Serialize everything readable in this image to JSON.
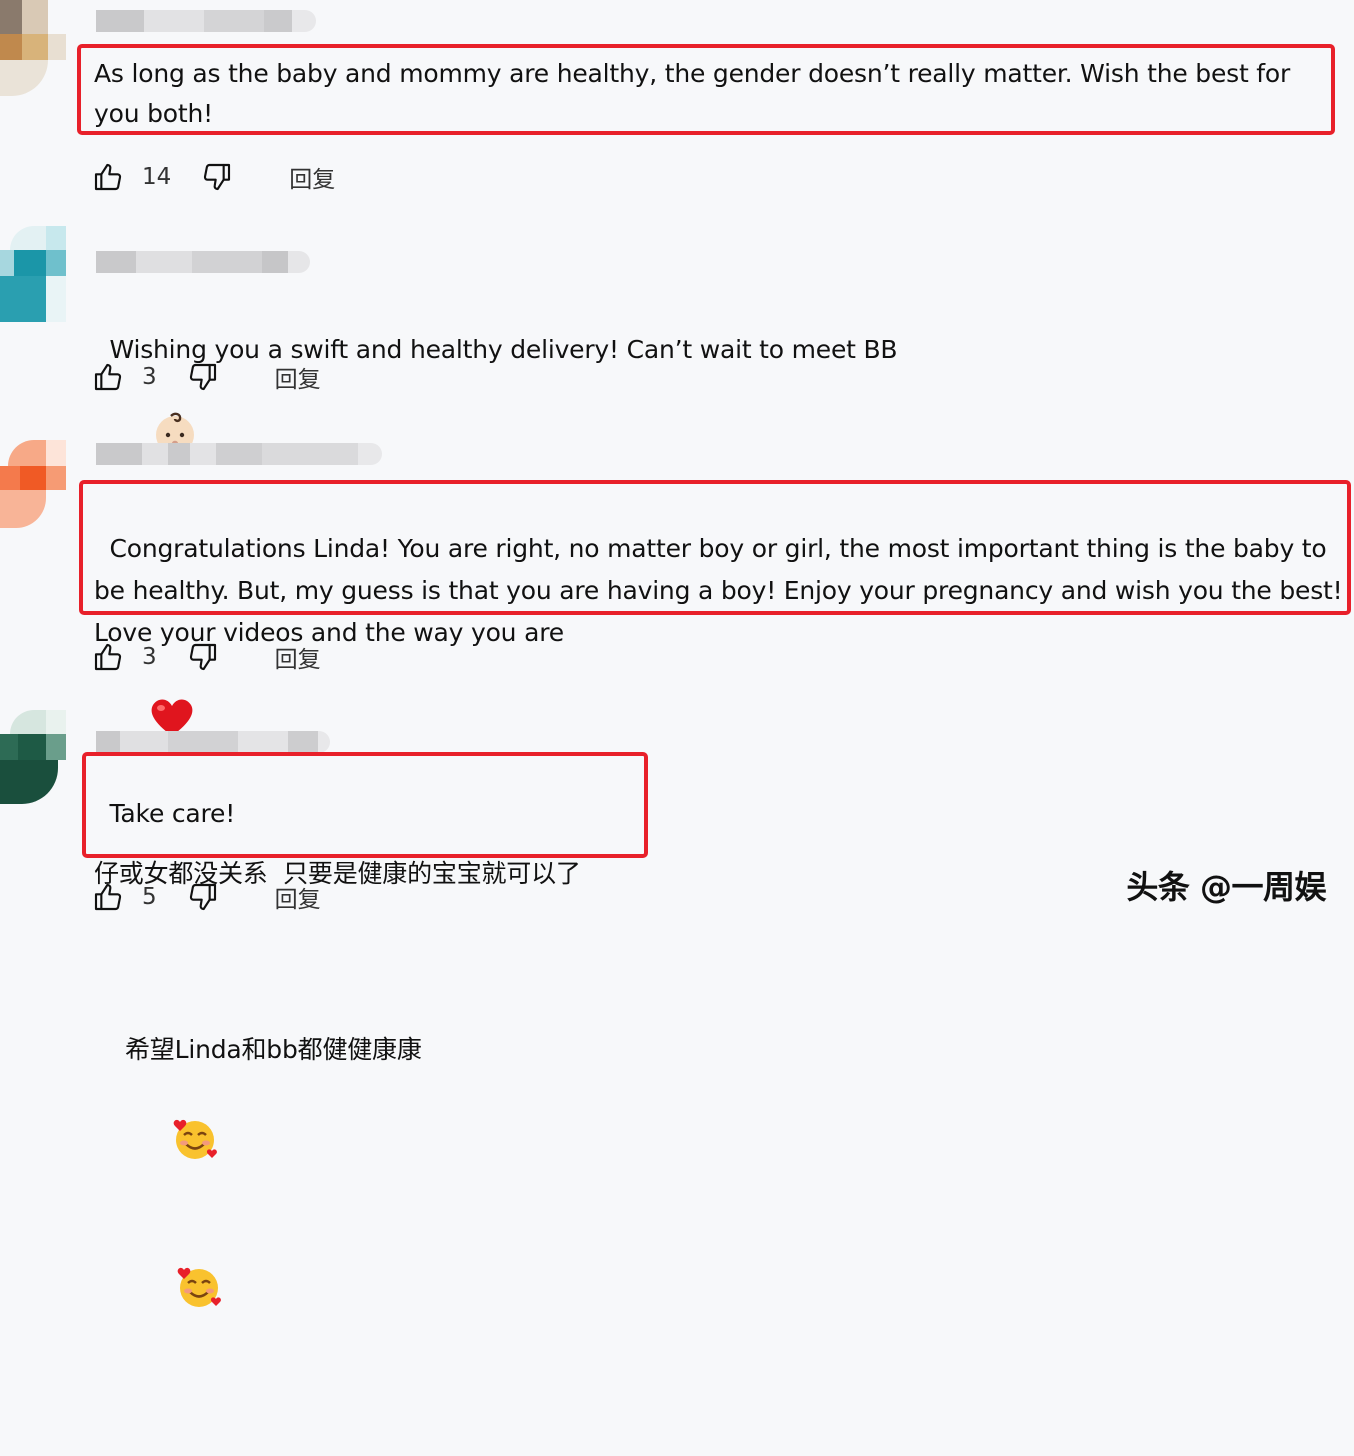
{
  "comments": [
    {
      "text": "As long as the baby and mommy are healthy, the gender doesn’t really matter. Wish the best for you both!",
      "likes": "14",
      "reply_label": "回复"
    },
    {
      "text": "Wishing you a swift and healthy delivery! Can’t wait to meet BB",
      "likes": "3",
      "reply_label": "回复"
    },
    {
      "text_part1": "Congratulations Linda! You are right, no matter boy or girl, the most important thing is the baby to be healthy. But, my guess is that you are having a boy! Enjoy your pregnancy and wish you the best! Love your videos and the way you are",
      "text_part2": "Take care!",
      "likes": "3",
      "reply_label": "回复"
    },
    {
      "line1": "仔或女都没关系  只要是健康的宝宝就可以了",
      "line2": "希望Linda和bb都健健康康",
      "likes": "5",
      "reply_label": "回复"
    }
  ],
  "watermark": "头条 @一周娱",
  "colors": {
    "highlight": "#e8202a",
    "background": "#f7f8fa"
  },
  "icons": [
    "thumbs-up-icon",
    "thumbs-down-icon",
    "baby-emoji",
    "red-heart-emoji",
    "smiling-face-with-hearts-emoji"
  ]
}
